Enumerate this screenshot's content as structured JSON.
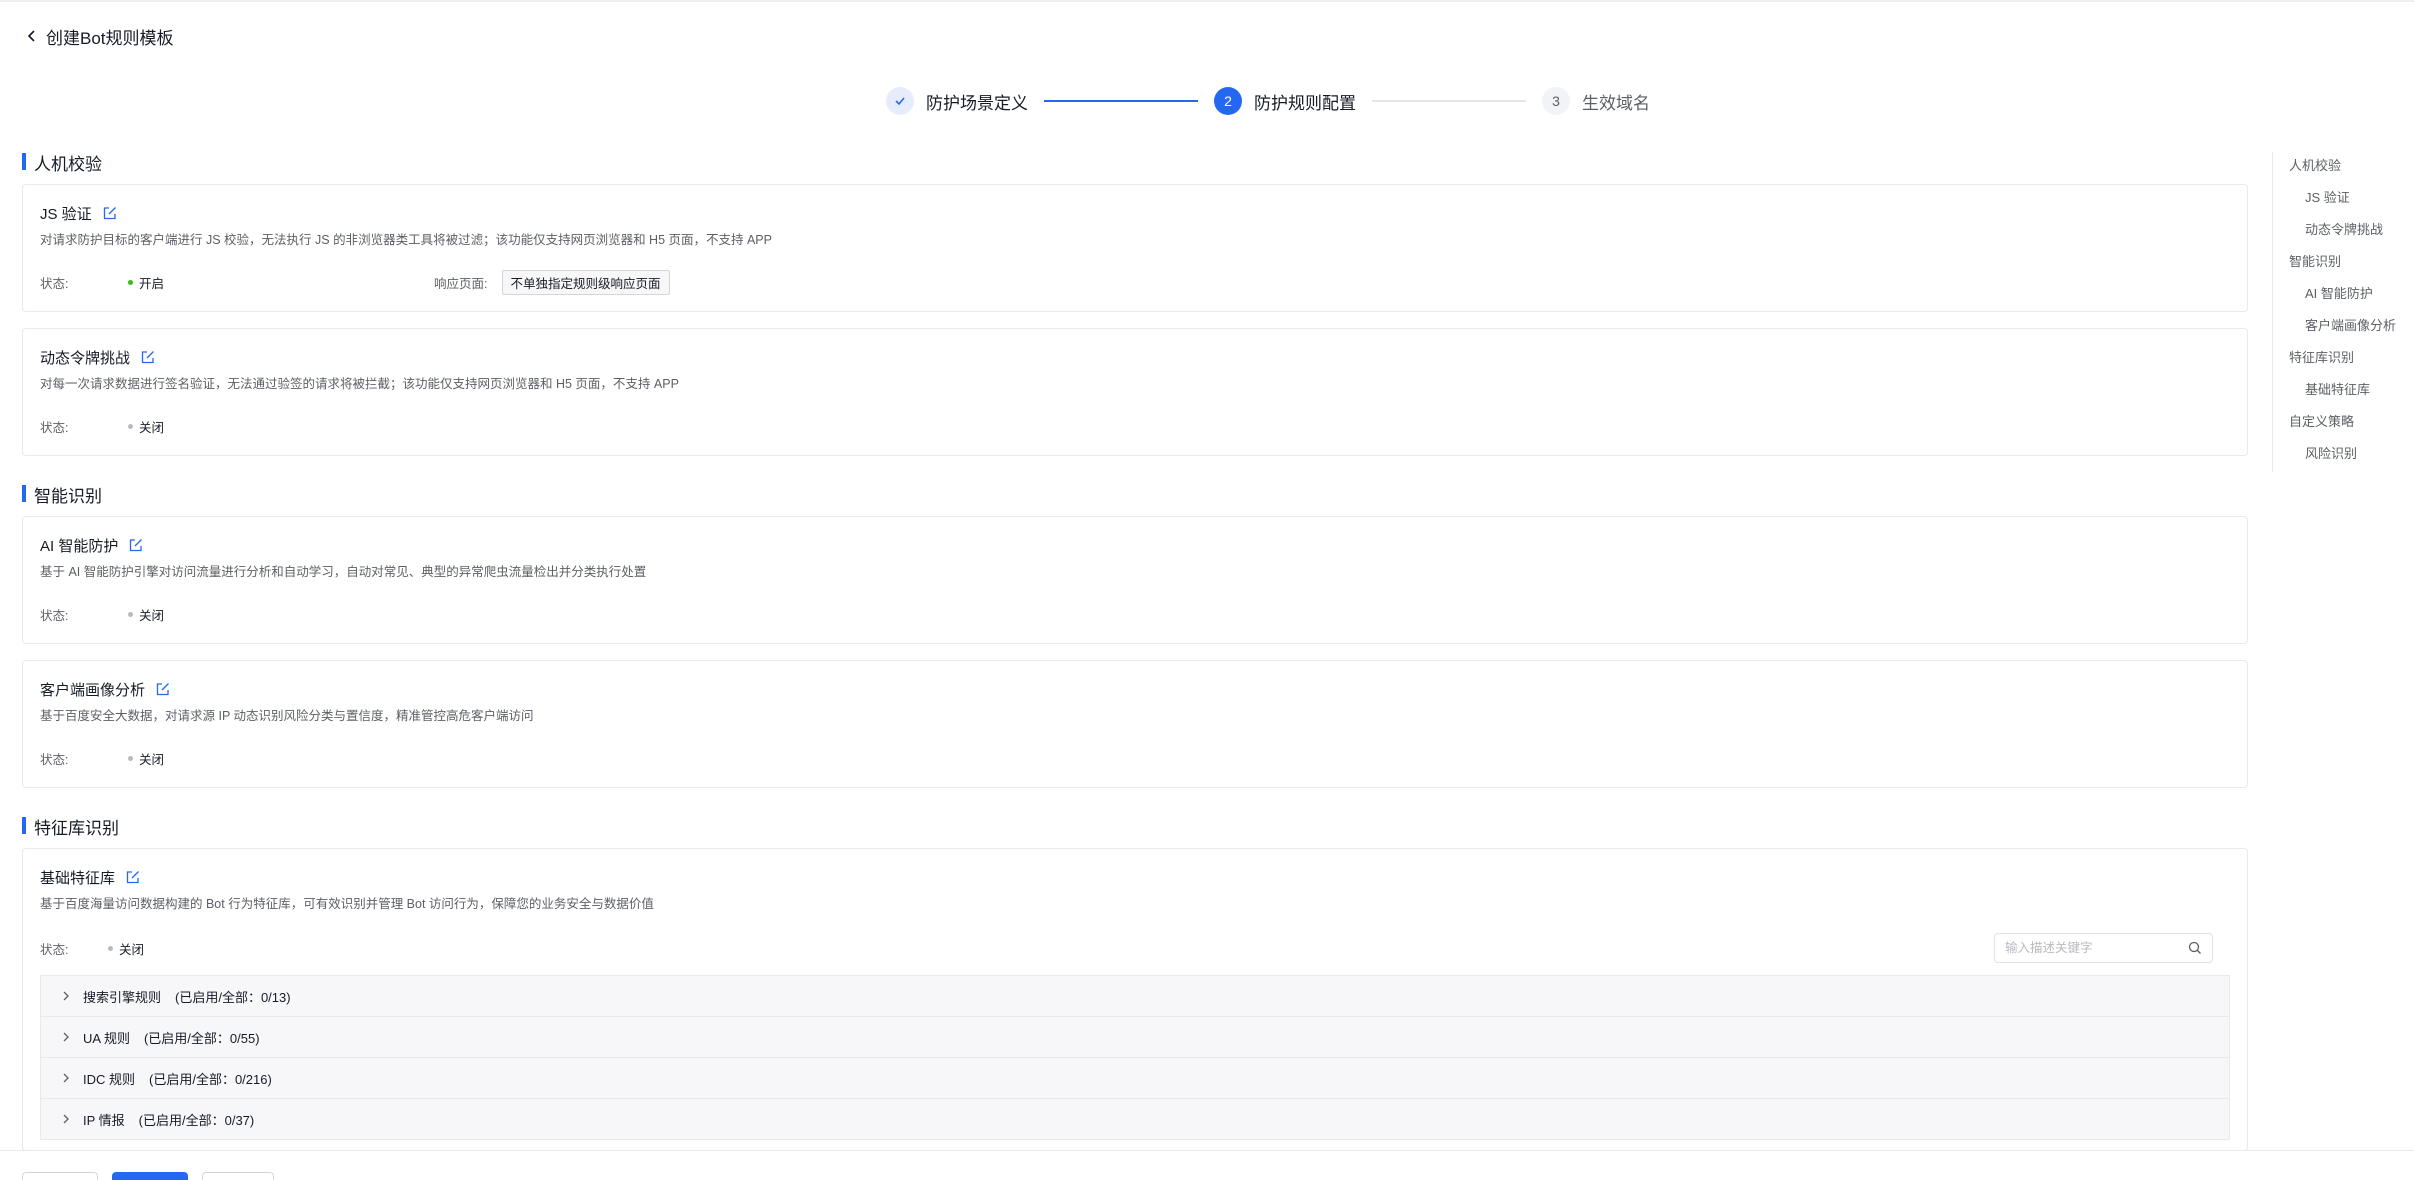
{
  "header": {
    "title": "创建Bot规则模板"
  },
  "steps": [
    {
      "label": "防护场景定义",
      "num": ""
    },
    {
      "label": "防护规则配置",
      "num": "2"
    },
    {
      "label": "生效域名",
      "num": "3"
    }
  ],
  "labels": {
    "status": "状态:",
    "response_page": "响应页面:"
  },
  "sections": {
    "human": {
      "title": "人机校验",
      "js": {
        "name": "JS 验证",
        "desc": "对请求防护目标的客户端进行 JS 校验，无法执行 JS 的非浏览器类工具将被过滤；该功能仅支持网页浏览器和 H5 页面，不支持 APP",
        "status": "开启",
        "response_tag": "不单独指定规则级响应页面"
      },
      "token": {
        "name": "动态令牌挑战",
        "desc": "对每一次请求数据进行签名验证，无法通过验签的请求将被拦截；该功能仅支持网页浏览器和 H5 页面，不支持 APP",
        "status": "关闭"
      }
    },
    "smart": {
      "title": "智能识别",
      "ai": {
        "name": "AI 智能防护",
        "desc": "基于 AI 智能防护引擎对访问流量进行分析和自动学习，自动对常见、典型的异常爬虫流量检出并分类执行处置",
        "status": "关闭"
      },
      "profile": {
        "name": "客户端画像分析",
        "desc": "基于百度安全大数据，对请求源 IP 动态识别风险分类与置信度，精准管控高危客户端访问",
        "status": "关闭"
      }
    },
    "feature": {
      "title": "特征库识别",
      "base": {
        "name": "基础特征库",
        "desc": "基于百度海量访问数据构建的 Bot 行为特征库，可有效识别并管理 Bot 访问行为，保障您的业务安全与数据价值",
        "status": "关闭",
        "search_placeholder": "输入描述关键字",
        "rules": [
          {
            "name": "搜索引擎规则",
            "count": "(已启用/全部：0/13)"
          },
          {
            "name": "UA 规则",
            "count": "(已启用/全部：0/55)"
          },
          {
            "name": "IDC 规则",
            "count": "(已启用/全部：0/216)"
          },
          {
            "name": "IP 情报",
            "count": "(已启用/全部：0/37)"
          }
        ]
      }
    }
  },
  "anchor": [
    {
      "label": "人机校验",
      "level": 1
    },
    {
      "label": "JS 验证",
      "level": 2
    },
    {
      "label": "动态令牌挑战",
      "level": 2
    },
    {
      "label": "智能识别",
      "level": 1
    },
    {
      "label": "AI 智能防护",
      "level": 2
    },
    {
      "label": "客户端画像分析",
      "level": 2
    },
    {
      "label": "特征库识别",
      "level": 1
    },
    {
      "label": "基础特征库",
      "level": 2
    },
    {
      "label": "自定义策略",
      "level": 1
    },
    {
      "label": "风险识别",
      "level": 2
    }
  ],
  "colors": {
    "accent": "#2468f2",
    "status_on": "#30bf13",
    "status_off": "#b8babf"
  }
}
